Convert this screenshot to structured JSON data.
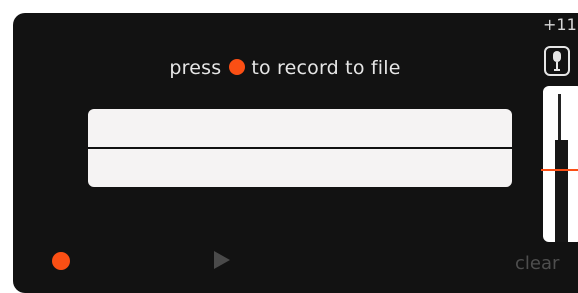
{
  "header": {
    "prefix": "press",
    "suffix": "to record to file"
  },
  "controls": {
    "clear_label": "clear"
  },
  "gain": {
    "label": "+11"
  },
  "meter": {
    "level_fraction": 0.65,
    "marker_fraction": 0.47
  },
  "colors": {
    "accent": "#fb4f14",
    "panel": "#121212",
    "waveform_bg": "#f5f3f3"
  },
  "icons": {
    "record": "record-dot-icon",
    "play": "play-triangle-icon",
    "mic": "microphone-icon"
  }
}
